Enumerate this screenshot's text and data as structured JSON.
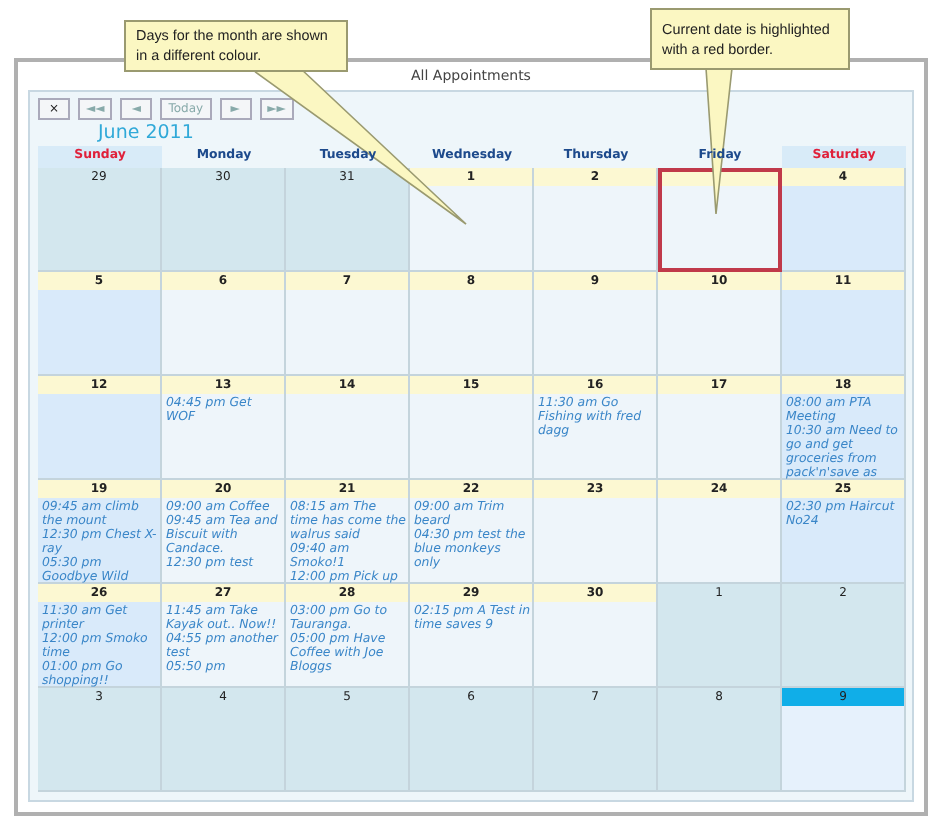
{
  "callouts": [
    {
      "text": "Days for the month are shown in a different  colour."
    },
    {
      "text": "Current date is highlighted with a red border."
    }
  ],
  "window": {
    "title": "All Appointments"
  },
  "toolbar": {
    "buttons": [
      "×",
      "◄◄",
      "◄",
      "Today",
      "►",
      "►►"
    ]
  },
  "month_title": "June 2011",
  "weekdays": [
    "Sunday",
    "Monday",
    "Tuesday",
    "Wednesday",
    "Thursday",
    "Friday",
    "Saturday"
  ],
  "weeks": [
    [
      {
        "date": "29",
        "in_month": false,
        "today": false,
        "selected": false
      },
      {
        "date": "30",
        "in_month": false,
        "today": false,
        "selected": false
      },
      {
        "date": "31",
        "in_month": false,
        "today": false,
        "selected": false
      },
      {
        "date": "1",
        "in_month": true,
        "today": false,
        "selected": false
      },
      {
        "date": "2",
        "in_month": true,
        "today": false,
        "selected": false
      },
      {
        "in_month": true,
        "today": true,
        "selected": false
      },
      {
        "date": "4",
        "in_month": true,
        "today": false,
        "selected": false
      }
    ],
    [
      {
        "date": "5",
        "in_month": true,
        "today": false,
        "selected": false
      },
      {
        "date": "6",
        "in_month": true,
        "today": false,
        "selected": false
      },
      {
        "date": "7",
        "in_month": true,
        "today": false,
        "selected": false
      },
      {
        "date": "8",
        "in_month": true,
        "today": false,
        "selected": false
      },
      {
        "date": "9",
        "in_month": true,
        "today": false,
        "selected": false
      },
      {
        "date": "10",
        "in_month": true,
        "today": false,
        "selected": false
      },
      {
        "date": "11",
        "in_month": true,
        "today": false,
        "selected": false
      }
    ],
    [
      {
        "date": "12",
        "in_month": true,
        "today": false,
        "selected": false
      },
      {
        "date": "13",
        "in_month": true,
        "today": false,
        "selected": false,
        "events": [
          "04:45 pm Get WOF"
        ]
      },
      {
        "date": "14",
        "in_month": true,
        "today": false,
        "selected": false
      },
      {
        "date": "15",
        "in_month": true,
        "today": false,
        "selected": false
      },
      {
        "date": "16",
        "in_month": true,
        "today": false,
        "selected": false,
        "events": [
          "11:30 am Go Fishing with fred dagg"
        ]
      },
      {
        "date": "17",
        "in_month": true,
        "today": false,
        "selected": false
      },
      {
        "date": "18",
        "in_month": true,
        "today": false,
        "selected": false,
        "events": [
          "08:00 am PTA Meeting",
          "10:30 am Need to go and get groceries from pack'n'save as"
        ]
      }
    ],
    [
      {
        "date": "19",
        "in_month": true,
        "today": false,
        "selected": false,
        "events": [
          "09:45 am climb the mount",
          "12:30 pm Chest X-ray",
          "05:30 pm Goodbye Wild"
        ]
      },
      {
        "date": "20",
        "in_month": true,
        "today": false,
        "selected": false,
        "events": [
          "09:00 am Coffee",
          "09:45 am Tea and Biscuit with Candace.",
          "12:30 pm test"
        ]
      },
      {
        "date": "21",
        "in_month": true,
        "today": false,
        "selected": false,
        "events": [
          "08:15 am The time has come the walrus said",
          "09:40 am Smoko!1",
          "12:00 pm Pick up"
        ]
      },
      {
        "date": "22",
        "in_month": true,
        "today": false,
        "selected": false,
        "events": [
          "09:00 am Trim beard",
          "04:30 pm test the blue monkeys only"
        ]
      },
      {
        "date": "23",
        "in_month": true,
        "today": false,
        "selected": false
      },
      {
        "date": "24",
        "in_month": true,
        "today": false,
        "selected": false
      },
      {
        "date": "25",
        "in_month": true,
        "today": false,
        "selected": false,
        "events": [
          "02:30 pm Haircut No24"
        ]
      }
    ],
    [
      {
        "date": "26",
        "in_month": true,
        "today": false,
        "selected": false,
        "events": [
          "11:30 am Get printer",
          "12:00 pm Smoko time",
          "01:00 pm Go shopping!!"
        ]
      },
      {
        "date": "27",
        "in_month": true,
        "today": false,
        "selected": false,
        "events": [
          "11:45 am Take Kayak out.. Now!!",
          "04:55 pm another test",
          "05:50 pm"
        ]
      },
      {
        "date": "28",
        "in_month": true,
        "today": false,
        "selected": false,
        "events": [
          "03:00 pm Go to Tauranga.",
          "05:00 pm Have Coffee with Joe Bloggs"
        ]
      },
      {
        "date": "29",
        "in_month": true,
        "today": false,
        "selected": false,
        "events": [
          "02:15 pm A Test in time saves 9"
        ]
      },
      {
        "date": "30",
        "in_month": true,
        "today": false,
        "selected": false
      },
      {
        "date": "1",
        "in_month": false,
        "today": false,
        "selected": false
      },
      {
        "date": "2",
        "in_month": false,
        "today": false,
        "selected": false
      }
    ],
    [
      {
        "date": "3",
        "in_month": false,
        "today": false,
        "selected": false
      },
      {
        "date": "4",
        "in_month": false,
        "today": false,
        "selected": false
      },
      {
        "date": "5",
        "in_month": false,
        "today": false,
        "selected": false
      },
      {
        "date": "6",
        "in_month": false,
        "today": false,
        "selected": false
      },
      {
        "date": "7",
        "in_month": false,
        "today": false,
        "selected": false
      },
      {
        "date": "8",
        "in_month": false,
        "today": false,
        "selected": false
      },
      {
        "date": "9",
        "in_month": false,
        "today": false,
        "selected": true
      }
    ]
  ]
}
